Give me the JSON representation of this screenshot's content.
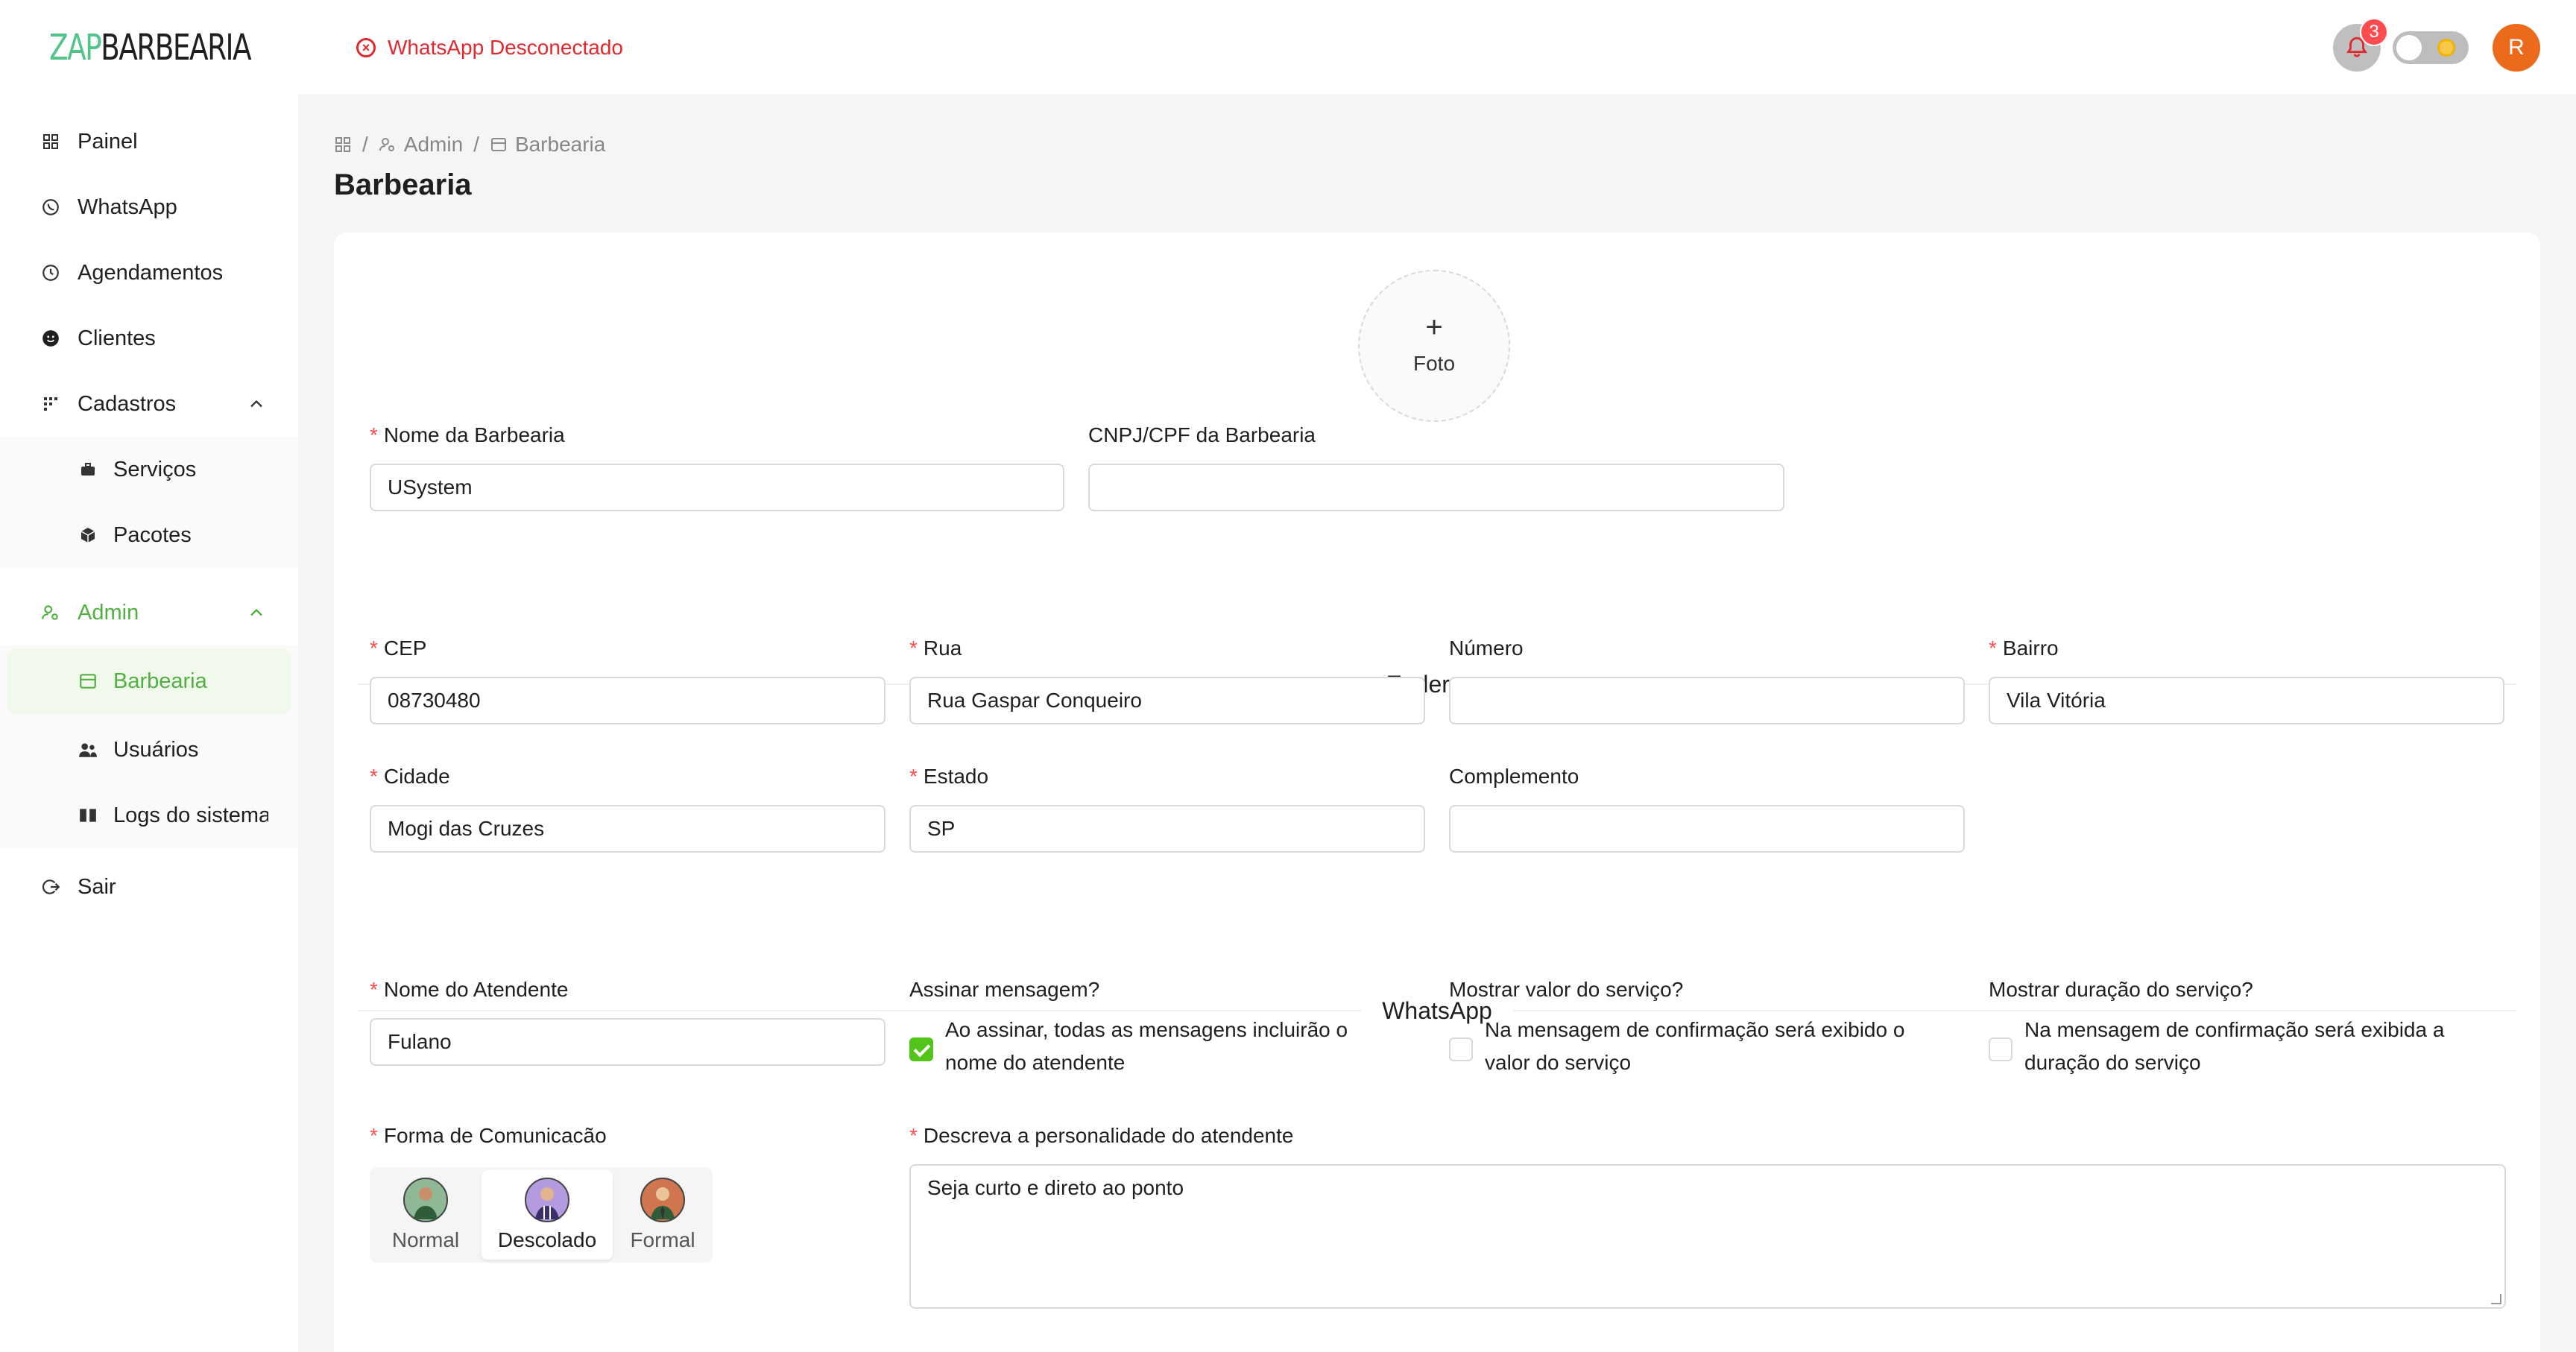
{
  "header": {
    "logo_zap": "ZAP",
    "logo_rest": "BARBEARIA",
    "whatsapp_status": "WhatsApp Desconectado",
    "notification_count": "3",
    "avatar_initial": "R"
  },
  "sidebar": {
    "items": [
      {
        "label": "Painel",
        "icon": "dashboard-icon"
      },
      {
        "label": "WhatsApp",
        "icon": "whatsapp-icon"
      },
      {
        "label": "Agendamentos",
        "icon": "clock-icon"
      },
      {
        "label": "Clientes",
        "icon": "smile-icon"
      },
      {
        "label": "Cadastros",
        "icon": "grid-dots-icon"
      },
      {
        "label": "Admin",
        "icon": "user-gear-icon"
      },
      {
        "label": "Sair",
        "icon": "logout-icon"
      }
    ],
    "cadastros_sub": [
      {
        "label": "Serviços",
        "icon": "briefcase-icon"
      },
      {
        "label": "Pacotes",
        "icon": "package-icon"
      }
    ],
    "admin_sub": [
      {
        "label": "Barbearia",
        "icon": "shop-icon"
      },
      {
        "label": "Usuários",
        "icon": "users-icon"
      },
      {
        "label": "Logs do sistema",
        "icon": "book-icon"
      }
    ]
  },
  "breadcrumb": {
    "admin": "Admin",
    "current": "Barbearia",
    "separator": "/"
  },
  "page": {
    "title": "Barbearia"
  },
  "form": {
    "photo_label": "Foto",
    "name_label": "Nome da Barbearia",
    "name_value": "USystem",
    "cnpj_label": "CNPJ/CPF da Barbearia",
    "cnpj_value": "",
    "address_section": "Endereço",
    "cep_label": "CEP",
    "cep_value": "08730480",
    "street_label": "Rua",
    "street_value": "Rua Gaspar Conqueiro",
    "number_label": "Número",
    "number_value": "",
    "district_label": "Bairro",
    "district_value": "Vila Vitória",
    "city_label": "Cidade",
    "city_value": "Mogi das Cruzes",
    "state_label": "Estado",
    "state_value": "SP",
    "complement_label": "Complemento",
    "complement_value": "",
    "whatsapp_section": "WhatsApp",
    "attendant_label": "Nome do Atendente",
    "attendant_value": "Fulano",
    "sign_label": "Assinar mensagem?",
    "sign_text_1": "Ao assinar, todas as mensagens incluirão o",
    "sign_text_2": "nome do atendente",
    "sign_checked": true,
    "show_value_label": "Mostrar valor do serviço?",
    "show_value_text_1": "Na mensagem de confirmação será exibido o",
    "show_value_text_2": "valor do serviço",
    "show_value_checked": false,
    "show_duration_label": "Mostrar duração do serviço?",
    "show_duration_text_1": "Na mensagem de confirmação será exibida a",
    "show_duration_text_2": "duração do serviço",
    "show_duration_checked": false,
    "communication_label": "Forma de Comunicacão",
    "communication_options": [
      "Normal",
      "Descolado",
      "Formal"
    ],
    "communication_selected": "Descolado",
    "personality_label": "Descreva a personalidade do atendente",
    "personality_value": "Seja curto e direto ao ponto"
  },
  "colors": {
    "brand_green": "#52c489",
    "active_green": "#52b043",
    "error_red": "#e0282e",
    "avatar_orange": "#eb6a1c"
  }
}
